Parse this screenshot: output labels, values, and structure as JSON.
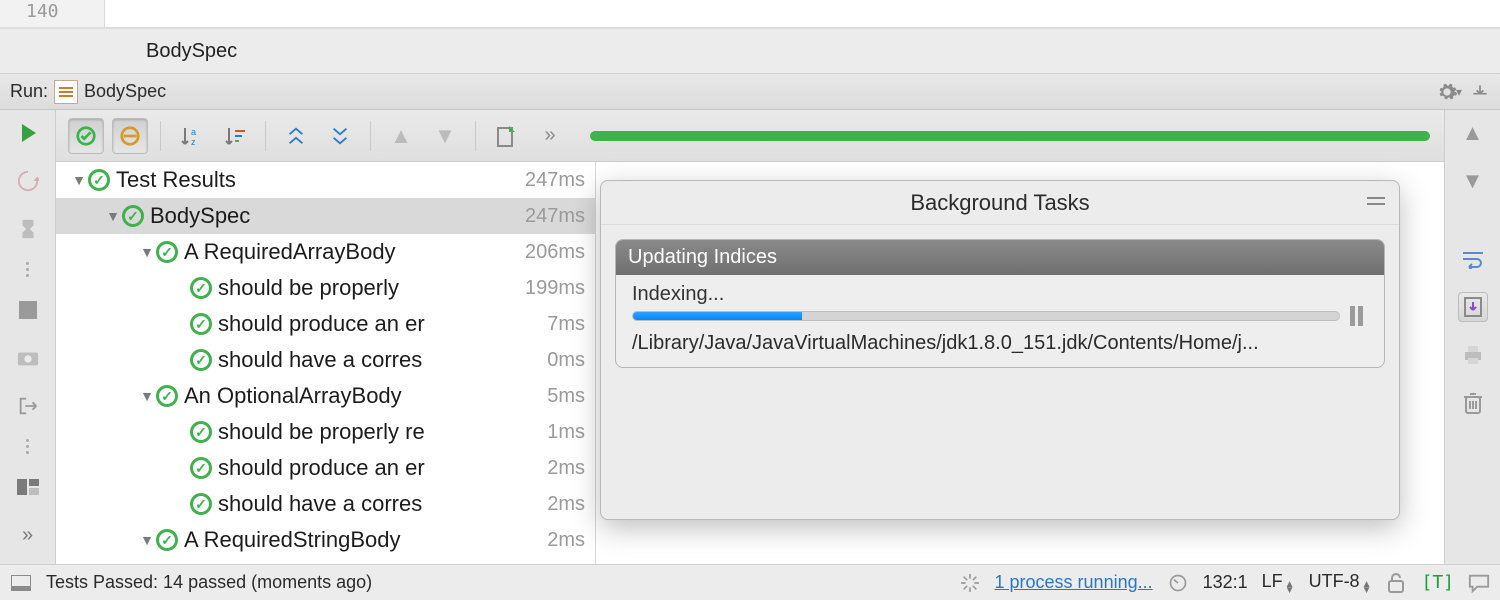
{
  "editor": {
    "gutter_line": "140"
  },
  "breadcrumb": {
    "item": "BodySpec"
  },
  "run_header": {
    "label": "Run:",
    "config_name": "BodySpec"
  },
  "run_header_icons": {
    "settings": "gear-icon",
    "collapse": "minimize-icon"
  },
  "test_toolbar": {
    "buttons": [
      {
        "name": "show-passed-toggle",
        "pressed": true
      },
      {
        "name": "show-ignored-toggle",
        "pressed": true
      },
      {
        "name": "sort-alpha-button",
        "pressed": false
      },
      {
        "name": "sort-duration-button",
        "pressed": false
      },
      {
        "name": "expand-all-button",
        "pressed": false
      },
      {
        "name": "collapse-all-button",
        "pressed": false
      },
      {
        "name": "prev-failed-button",
        "pressed": false
      },
      {
        "name": "next-failed-button",
        "pressed": false
      },
      {
        "name": "export-results-button",
        "pressed": false
      },
      {
        "name": "more-button",
        "pressed": false
      }
    ]
  },
  "tree": {
    "rows": [
      {
        "indent": 0,
        "expandable": true,
        "label": "Test Results",
        "time": "247ms",
        "selected": false
      },
      {
        "indent": 1,
        "expandable": true,
        "label": "BodySpec",
        "time": "247ms",
        "selected": true
      },
      {
        "indent": 2,
        "expandable": true,
        "label": "A RequiredArrayBody",
        "time": "206ms",
        "selected": false
      },
      {
        "indent": 3,
        "expandable": false,
        "label": "should be properly",
        "time": "199ms",
        "selected": false
      },
      {
        "indent": 3,
        "expandable": false,
        "label": "should produce an er",
        "time": "7ms",
        "selected": false
      },
      {
        "indent": 3,
        "expandable": false,
        "label": "should have a corres",
        "time": "0ms",
        "selected": false
      },
      {
        "indent": 2,
        "expandable": true,
        "label": "An OptionalArrayBody",
        "time": "5ms",
        "selected": false
      },
      {
        "indent": 3,
        "expandable": false,
        "label": "should be properly re",
        "time": "1ms",
        "selected": false
      },
      {
        "indent": 3,
        "expandable": false,
        "label": "should produce an er",
        "time": "2ms",
        "selected": false
      },
      {
        "indent": 3,
        "expandable": false,
        "label": "should have a corres",
        "time": "2ms",
        "selected": false
      },
      {
        "indent": 2,
        "expandable": true,
        "label": "A RequiredStringBody",
        "time": "2ms",
        "selected": false
      }
    ]
  },
  "bg_tasks": {
    "title": "Background Tasks",
    "task": {
      "heading": "Updating Indices",
      "status": "Indexing...",
      "progress_pct": 24,
      "path": "/Library/Java/JavaVirtualMachines/jdk1.8.0_151.jdk/Contents/Home/j..."
    }
  },
  "statusbar": {
    "tests_passed": "Tests Passed: 14 passed (moments ago)",
    "process_link": "1 process running...",
    "caret": "132:1",
    "line_sep": "LF",
    "encoding": "UTF-8",
    "inspect_badge": "[T]"
  }
}
